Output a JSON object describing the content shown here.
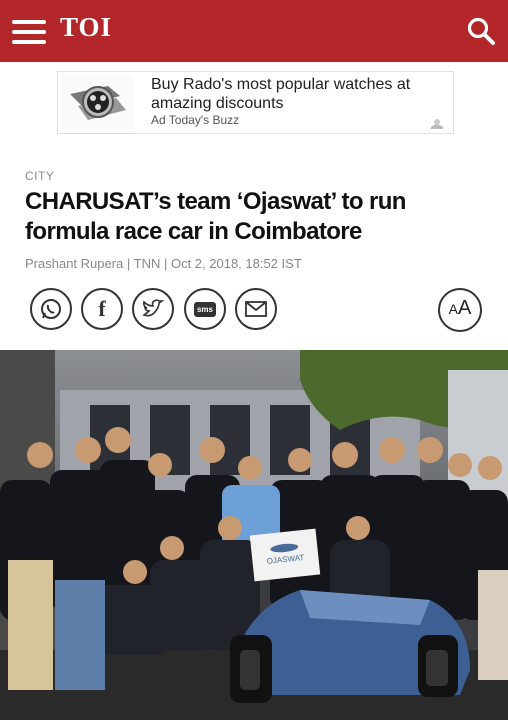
{
  "header": {
    "logo": "TOI",
    "menu_icon": "hamburger-menu-icon",
    "search_icon": "search-icon",
    "bg_color": "#b3272b"
  },
  "ad": {
    "title": "Buy Rado's most popular watches at amazing discounts",
    "source": "Ad Today's Buzz",
    "image_icon": "watch-image"
  },
  "article": {
    "section": "CITY",
    "headline": "CHARUSAT’s team ‘Ojaswat’ to run formula race car in Coimbatore",
    "byline": "Prashant Rupera | TNN | Oct 2, 2018, 18:52 IST",
    "share": [
      {
        "name": "whatsapp-share-icon"
      },
      {
        "name": "facebook-share-icon",
        "glyph": "f"
      },
      {
        "name": "twitter-share-icon"
      },
      {
        "name": "sms-share-icon",
        "glyph": "sms"
      },
      {
        "name": "email-share-icon"
      }
    ],
    "font_size": {
      "small": "A",
      "large": "A"
    },
    "photo_banner": "OJASWAT"
  }
}
